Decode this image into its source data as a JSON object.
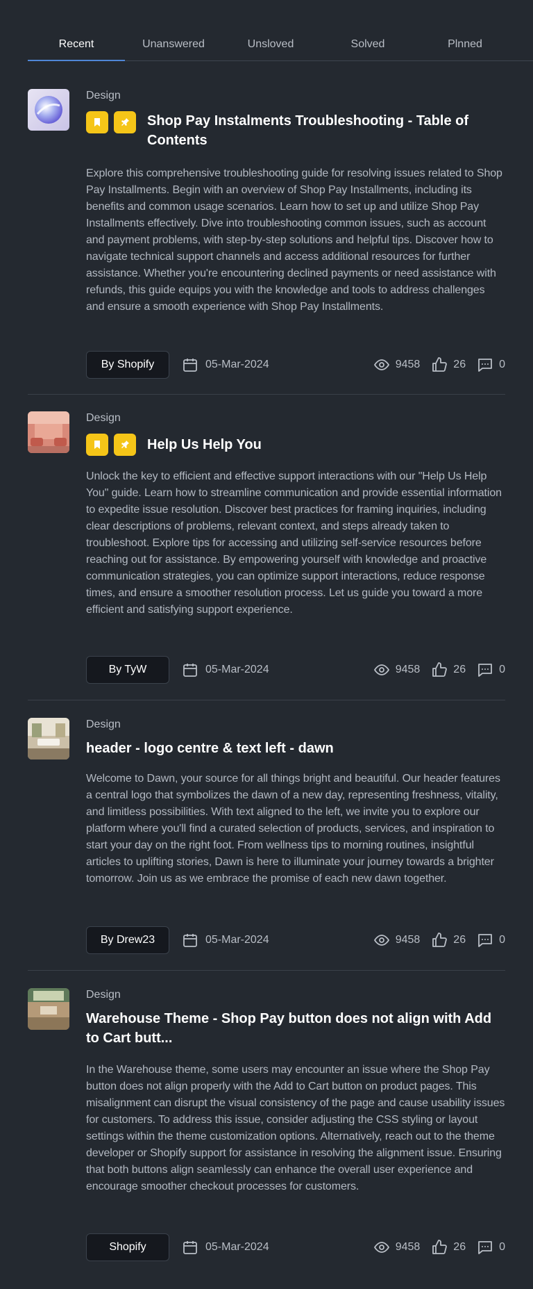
{
  "tabs": [
    {
      "label": "Recent"
    },
    {
      "label": "Unanswered"
    },
    {
      "label": "Unsloved"
    },
    {
      "label": "Solved"
    },
    {
      "label": "Plnned"
    }
  ],
  "posts": [
    {
      "category": "Design",
      "title": "Shop Pay Instalments Troubleshooting - Table of Contents",
      "body": "Explore this comprehensive troubleshooting guide for resolving issues related to Shop Pay Installments. Begin with an overview of Shop Pay Installments, including its benefits and common usage scenarios. Learn how to set up and utilize Shop Pay Installments effectively. Dive into troubleshooting common issues, such as account and payment problems, with step-by-step solutions and helpful tips. Discover how to navigate technical support channels and access additional resources for further assistance. Whether you're encountering declined payments or need assistance with refunds, this guide equips you with the knowledge and tools to address challenges and ensure a smooth experience with Shop Pay Installments.",
      "author": "By Shopify",
      "date": "05-Mar-2024",
      "views": "9458",
      "likes": "26",
      "comments": "0"
    },
    {
      "category": "Design",
      "title": "Help Us Help You",
      "body": "Unlock the key to efficient and effective support interactions with our \"Help Us Help You\" guide. Learn how to streamline communication and provide essential information to expedite issue resolution. Discover best practices for framing inquiries, including clear descriptions of problems, relevant context, and steps already taken to troubleshoot. Explore tips for accessing and utilizing self-service resources before reaching out for assistance. By empowering yourself with knowledge and proactive communication strategies, you can optimize support interactions, reduce response times, and ensure a smoother resolution process. Let us guide you toward a more efficient and satisfying support experience.",
      "author": "By TyW",
      "date": "05-Mar-2024",
      "views": "9458",
      "likes": "26",
      "comments": "0"
    },
    {
      "category": "Design",
      "title": "header - logo centre & text left  - dawn",
      "body": "Welcome to Dawn, your source for all things bright and beautiful. Our header features a central logo that symbolizes the dawn of a new day, representing freshness, vitality, and limitless possibilities. With text aligned to the left, we invite you to explore our platform where you'll find a curated selection of products, services, and inspiration to start your day on the right foot. From wellness tips to morning routines, insightful articles to uplifting stories, Dawn is here to illuminate your journey towards a brighter tomorrow. Join us as we embrace the promise of each new dawn together.",
      "author": "By Drew23",
      "date": "05-Mar-2024",
      "views": "9458",
      "likes": "26",
      "comments": "0"
    },
    {
      "category": "Design",
      "title": "Warehouse Theme - Shop Pay button does not align with Add to Cart butt...",
      "body": "In the Warehouse theme, some users may encounter an issue where the Shop Pay button does not align properly with the Add to Cart button on product pages. This misalignment can disrupt the visual consistency of the page and cause usability issues for customers. To address this issue, consider adjusting the CSS styling or layout settings within the theme customization options. Alternatively, reach out to the theme developer or Shopify support for assistance in resolving the alignment issue. Ensuring that both buttons align seamlessly can enhance the overall user experience and encourage smoother checkout processes for customers.",
      "author": "Shopify",
      "date": "05-Mar-2024",
      "views": "9458",
      "likes": "26",
      "comments": "0"
    }
  ]
}
